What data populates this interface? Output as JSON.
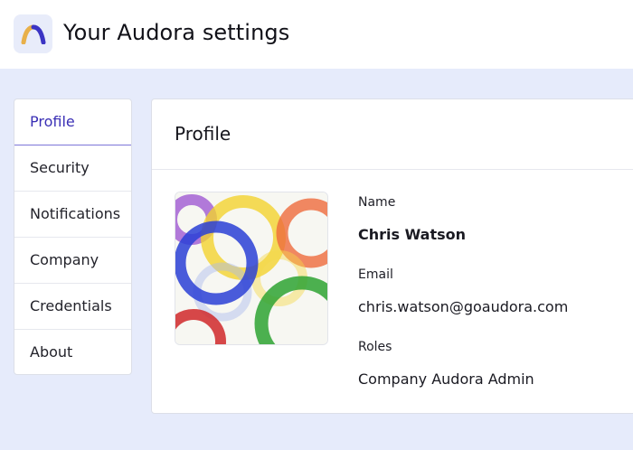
{
  "header": {
    "title": "Your Audora settings",
    "logo_icon": "audora-logo-icon"
  },
  "sidebar": {
    "items": [
      {
        "label": "Profile",
        "active": true
      },
      {
        "label": "Security"
      },
      {
        "label": "Notifications"
      },
      {
        "label": "Company"
      },
      {
        "label": "Credentials"
      },
      {
        "label": "About"
      }
    ]
  },
  "profile": {
    "title": "Profile",
    "name_label": "Name",
    "name_value": "Chris Watson",
    "email_label": "Email",
    "email_value": "chris.watson@goaudora.com",
    "roles_label": "Roles",
    "roles_value": "Company Audora Admin"
  },
  "colors": {
    "accent": "#3a2fb5",
    "page_background": "#e6ebfb",
    "logo_gold": "#e8b04a",
    "logo_indigo": "#3b34c4"
  }
}
